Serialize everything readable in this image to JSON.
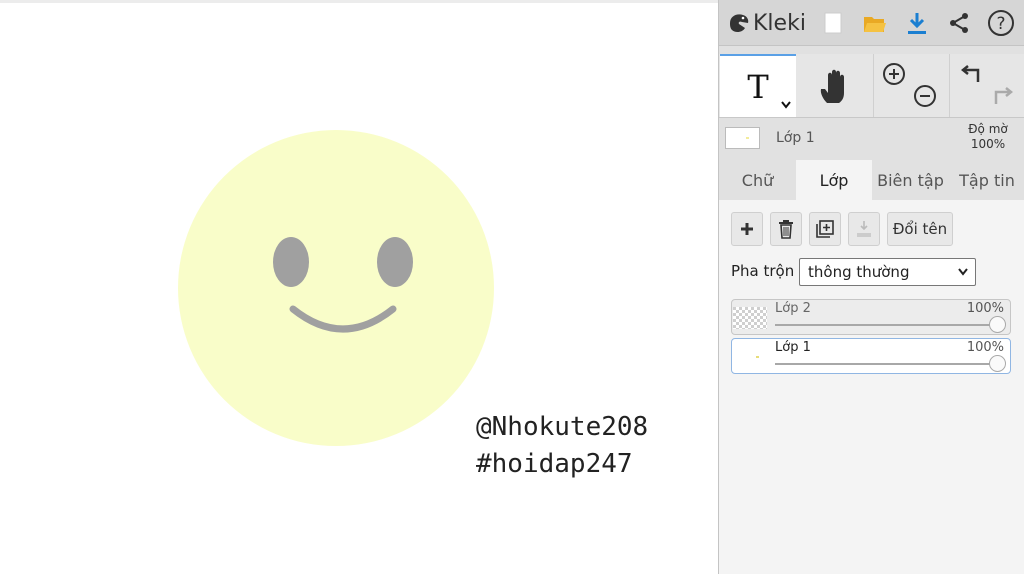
{
  "app": {
    "name": "Kleki"
  },
  "canvas": {
    "watermark_line1": "@Nhokute208",
    "watermark_line2": "#hoidap247",
    "colors": {
      "face": "#f9fdc9",
      "features": "#a0a0a0"
    }
  },
  "toolbar": {
    "icons": [
      "new-image-icon",
      "open-folder-icon",
      "download-icon",
      "share-icon",
      "help-icon"
    ],
    "help_label": "?"
  },
  "tools": {
    "text_tool_label": "T",
    "icons": [
      "hand-icon",
      "zoom-in-icon",
      "zoom-out-icon",
      "undo-icon",
      "redo-icon"
    ]
  },
  "layer_info": {
    "layer_name": "Lớp 1",
    "opacity_label": "Độ mờ",
    "opacity_value": "100%"
  },
  "tabs": [
    {
      "label": "Chữ",
      "active": false
    },
    {
      "label": "Lớp",
      "active": true
    },
    {
      "label": "Biên tập",
      "active": false
    },
    {
      "label": "Tập tin",
      "active": false
    }
  ],
  "layer_actions": {
    "icons": [
      "add-layer-icon",
      "delete-layer-icon",
      "duplicate-layer-icon",
      "merge-down-icon"
    ],
    "rename_label": "Đổi tên"
  },
  "blend": {
    "label": "Pha trộn",
    "selected": "thông thường"
  },
  "layers": [
    {
      "name": "Lớp 2",
      "opacity": "100%",
      "selected": false
    },
    {
      "name": "Lớp 1",
      "opacity": "100%",
      "selected": true
    }
  ],
  "colors": {
    "accent": "#1b7fd1",
    "folder": "#f5c242",
    "selection": "#90b6e3"
  }
}
